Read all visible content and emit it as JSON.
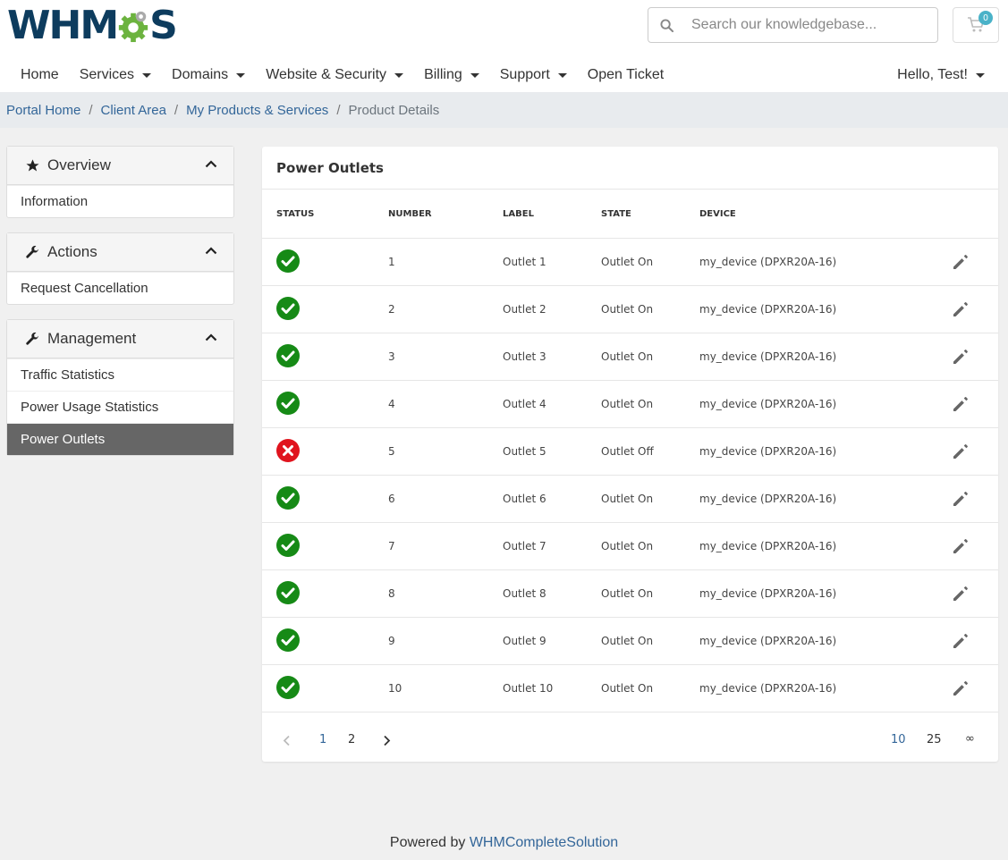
{
  "header": {
    "logo": "WHMCS",
    "search_placeholder": "Search our knowledgebase...",
    "cart_count": "0"
  },
  "nav": {
    "items": [
      {
        "label": "Home",
        "dropdown": false
      },
      {
        "label": "Services",
        "dropdown": true
      },
      {
        "label": "Domains",
        "dropdown": true
      },
      {
        "label": "Website & Security",
        "dropdown": true
      },
      {
        "label": "Billing",
        "dropdown": true
      },
      {
        "label": "Support",
        "dropdown": true
      },
      {
        "label": "Open Ticket",
        "dropdown": false
      }
    ],
    "user": "Hello, Test!"
  },
  "breadcrumb": {
    "items": [
      "Portal Home",
      "Client Area",
      "My Products & Services"
    ],
    "current": "Product Details"
  },
  "sidebar": {
    "overview": {
      "title": "Overview",
      "items": [
        "Information"
      ]
    },
    "actions": {
      "title": "Actions",
      "items": [
        "Request Cancellation"
      ]
    },
    "management": {
      "title": "Management",
      "items": [
        "Traffic Statistics",
        "Power Usage Statistics",
        "Power Outlets"
      ],
      "active": "Power Outlets"
    }
  },
  "card": {
    "title": "Power Outlets",
    "columns": [
      "STATUS",
      "NUMBER",
      "LABEL",
      "STATE",
      "DEVICE"
    ],
    "rows": [
      {
        "status": "on",
        "number": "1",
        "label": "Outlet 1",
        "state": "Outlet On",
        "device": "my_device (DPXR20A-16)"
      },
      {
        "status": "on",
        "number": "2",
        "label": "Outlet 2",
        "state": "Outlet On",
        "device": "my_device (DPXR20A-16)"
      },
      {
        "status": "on",
        "number": "3",
        "label": "Outlet 3",
        "state": "Outlet On",
        "device": "my_device (DPXR20A-16)"
      },
      {
        "status": "on",
        "number": "4",
        "label": "Outlet 4",
        "state": "Outlet On",
        "device": "my_device (DPXR20A-16)"
      },
      {
        "status": "off",
        "number": "5",
        "label": "Outlet 5",
        "state": "Outlet Off",
        "device": "my_device (DPXR20A-16)"
      },
      {
        "status": "on",
        "number": "6",
        "label": "Outlet 6",
        "state": "Outlet On",
        "device": "my_device (DPXR20A-16)"
      },
      {
        "status": "on",
        "number": "7",
        "label": "Outlet 7",
        "state": "Outlet On",
        "device": "my_device (DPXR20A-16)"
      },
      {
        "status": "on",
        "number": "8",
        "label": "Outlet 8",
        "state": "Outlet On",
        "device": "my_device (DPXR20A-16)"
      },
      {
        "status": "on",
        "number": "9",
        "label": "Outlet 9",
        "state": "Outlet On",
        "device": "my_device (DPXR20A-16)"
      },
      {
        "status": "on",
        "number": "10",
        "label": "Outlet 10",
        "state": "Outlet On",
        "device": "my_device (DPXR20A-16)"
      }
    ],
    "pagination": {
      "pages": [
        "1",
        "2"
      ],
      "current": "1",
      "page_sizes": [
        "10",
        "25",
        "∞"
      ],
      "current_size": "10"
    }
  },
  "footer": {
    "prefix": "Powered by ",
    "link": "WHMCompleteSolution"
  },
  "colors": {
    "on": "#168a16",
    "off": "#e0141e",
    "link": "#336699",
    "active_bg": "#666666",
    "brand": "#0d3c5e",
    "gear": "#6cb33f"
  }
}
